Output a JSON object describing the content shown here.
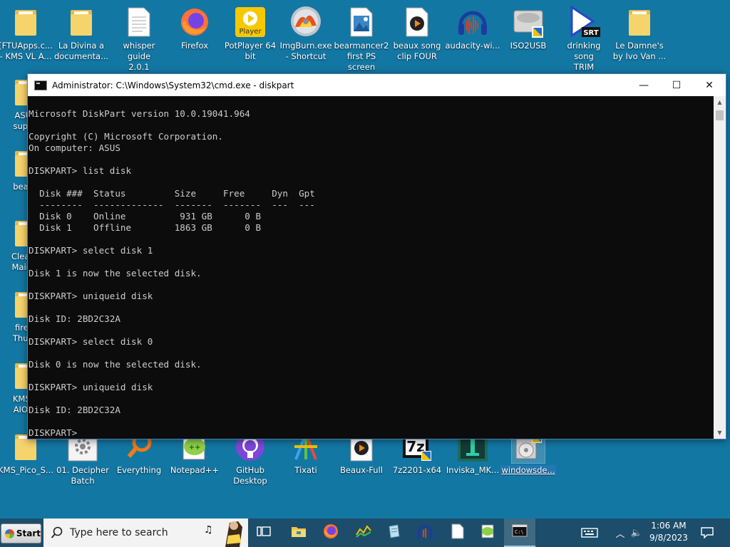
{
  "desktop": {
    "top_row": [
      {
        "label": "[FTUApps.c...\n- KMS VL A...",
        "icon": "folder-icon"
      },
      {
        "label": "La Divina a\ndocumenta...",
        "icon": "folder-icon"
      },
      {
        "label": "whisper guide\n2.0.1",
        "icon": "text-document-icon"
      },
      {
        "label": "Firefox",
        "icon": "firefox-icon"
      },
      {
        "label": "PotPlayer 64\nbit",
        "icon": "potplayer-icon",
        "badge": "Player"
      },
      {
        "label": "ImgBurn.exe\n- Shortcut",
        "icon": "imgburn-disc-icon"
      },
      {
        "label": "bearmancer2\nfirst PS screen",
        "icon": "image-file-icon"
      },
      {
        "label": "beaux song\nclip FOUR",
        "icon": "video-file-icon"
      },
      {
        "label": "audacity-wi...",
        "icon": "audacity-icon"
      },
      {
        "label": "ISO2USB",
        "icon": "iso2usb-drive-icon"
      },
      {
        "label": "drinking song\nTRIM",
        "icon": "srt-media-icon",
        "badge": "SRT"
      },
      {
        "label": "Le Damne's\nby Ivo Van ...",
        "icon": "folder-icon"
      }
    ],
    "left_column": [
      {
        "label": "ASUS\nsuppo",
        "icon": "folder-icon"
      },
      {
        "label": "beaux",
        "icon": "folder-icon"
      },
      {
        "label": "Cleanu\nMainte",
        "icon": "folder-icon"
      },
      {
        "label": "firefo\nThund",
        "icon": "folder-icon"
      },
      {
        "label": "KMS V\nAIO v-",
        "icon": "folder-icon"
      }
    ],
    "bottom_row": [
      {
        "label": "KMS_Pico_S...",
        "icon": "folder-icon"
      },
      {
        "label": "01. Decipher\nBatch",
        "icon": "gear-batch-icon"
      },
      {
        "label": "Everything",
        "icon": "everything-search-icon"
      },
      {
        "label": "Notepad++",
        "icon": "notepadpp-icon"
      },
      {
        "label": "GitHub\nDesktop",
        "icon": "github-icon"
      },
      {
        "label": "Tixati",
        "icon": "tixati-icon"
      },
      {
        "label": "Beaux-Full",
        "icon": "video-file-icon"
      },
      {
        "label": "7z2201-x64",
        "icon": "7zip-installer-icon"
      },
      {
        "label": "Inviska_MK...",
        "icon": "inviska-icon"
      },
      {
        "label": "windowsde...",
        "icon": "windows-installer-icon",
        "selected": true
      }
    ]
  },
  "cmd_window": {
    "title": "Administrator: C:\\Windows\\System32\\cmd.exe - diskpart",
    "minimize_glyph": "—",
    "maximize_glyph": "☐",
    "close_glyph": "✕",
    "lines": [
      "Microsoft DiskPart version 10.0.19041.964",
      "",
      "Copyright (C) Microsoft Corporation.",
      "On computer: ASUS",
      "",
      "DISKPART> list disk",
      "",
      "  Disk ###  Status         Size     Free     Dyn  Gpt",
      "  --------  -------------  -------  -------  ---  ---",
      "  Disk 0    Online          931 GB      0 B",
      "  Disk 1    Offline        1863 GB      0 B",
      "",
      "DISKPART> select disk 1",
      "",
      "Disk 1 is now the selected disk.",
      "",
      "DISKPART> uniqueid disk",
      "",
      "Disk ID: 2BD2C32A",
      "",
      "DISKPART> select disk 0",
      "",
      "Disk 0 is now the selected disk.",
      "",
      "DISKPART> uniqueid disk",
      "",
      "Disk ID: 2BD2C32A",
      "",
      "DISKPART> "
    ]
  },
  "taskbar": {
    "start_label": "Start",
    "search_placeholder": "Type here to search",
    "pinned": [
      "task-view-icon",
      "file-explorer-icon",
      "firefox-icon",
      "chart-app-icon",
      "notepad-icon",
      "audacity-icon",
      "text-file-icon",
      "notepadpp-icon",
      "cmd-icon"
    ],
    "active": "cmd-icon",
    "time": "1:06 AM",
    "date": "9/8/2023",
    "colors": {
      "taskbar": "#1c4d6b",
      "desktop": "#1377a3"
    }
  }
}
